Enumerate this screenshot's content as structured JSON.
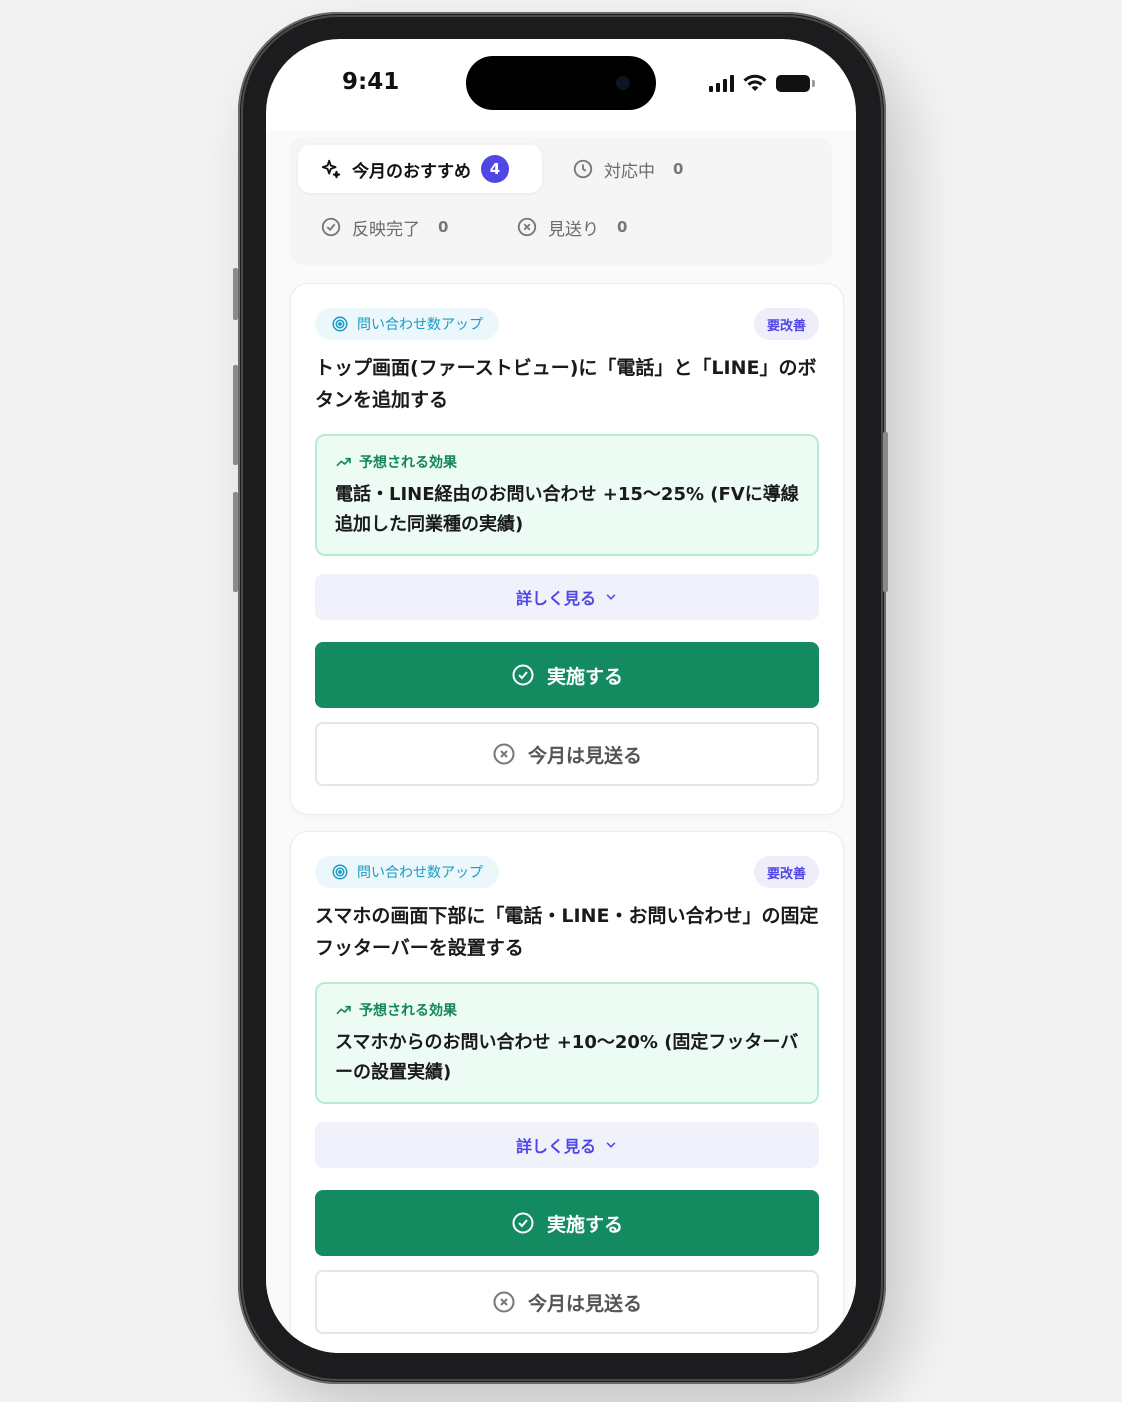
{
  "status_bar": {
    "time": "9:41"
  },
  "tabs": [
    {
      "label": "今月のおすすめ",
      "badge": "4",
      "icon": "sparkle-icon"
    },
    {
      "label": "対応中",
      "count": "0",
      "icon": "clock-icon"
    },
    {
      "label": "反映完了",
      "count": "0",
      "icon": "check-circle-icon"
    },
    {
      "label": "見送り",
      "count": "0",
      "icon": "x-circle-icon"
    }
  ],
  "cards": [
    {
      "category": "問い合わせ数アップ",
      "priority": "要改善",
      "title": "トップ画面(ファーストビュー)に「電話」と「LINE」のボタンを追加する",
      "effect_label": "予想される効果",
      "effect_text": "電話・LINE経由のお問い合わせ +15〜25% (FVに導線追加した同業種の実績)",
      "more_label": "詳しく見る",
      "do_label": "実施する",
      "skip_label": "今月は見送る"
    },
    {
      "category": "問い合わせ数アップ",
      "priority": "要改善",
      "title": "スマホの画面下部に「電話・LINE・お問い合わせ」の固定フッターバーを設置する",
      "effect_label": "予想される効果",
      "effect_text": "スマホからのお問い合わせ +10〜20% (固定フッターバーの設置実績)",
      "more_label": "詳しく見る",
      "do_label": "実施する",
      "skip_label": "今月は見送る"
    }
  ],
  "colors": {
    "accent": "#4f46e5",
    "primary_action": "#138a60",
    "category": "#1a9bc6",
    "effect_bg": "#ecfbf3"
  }
}
